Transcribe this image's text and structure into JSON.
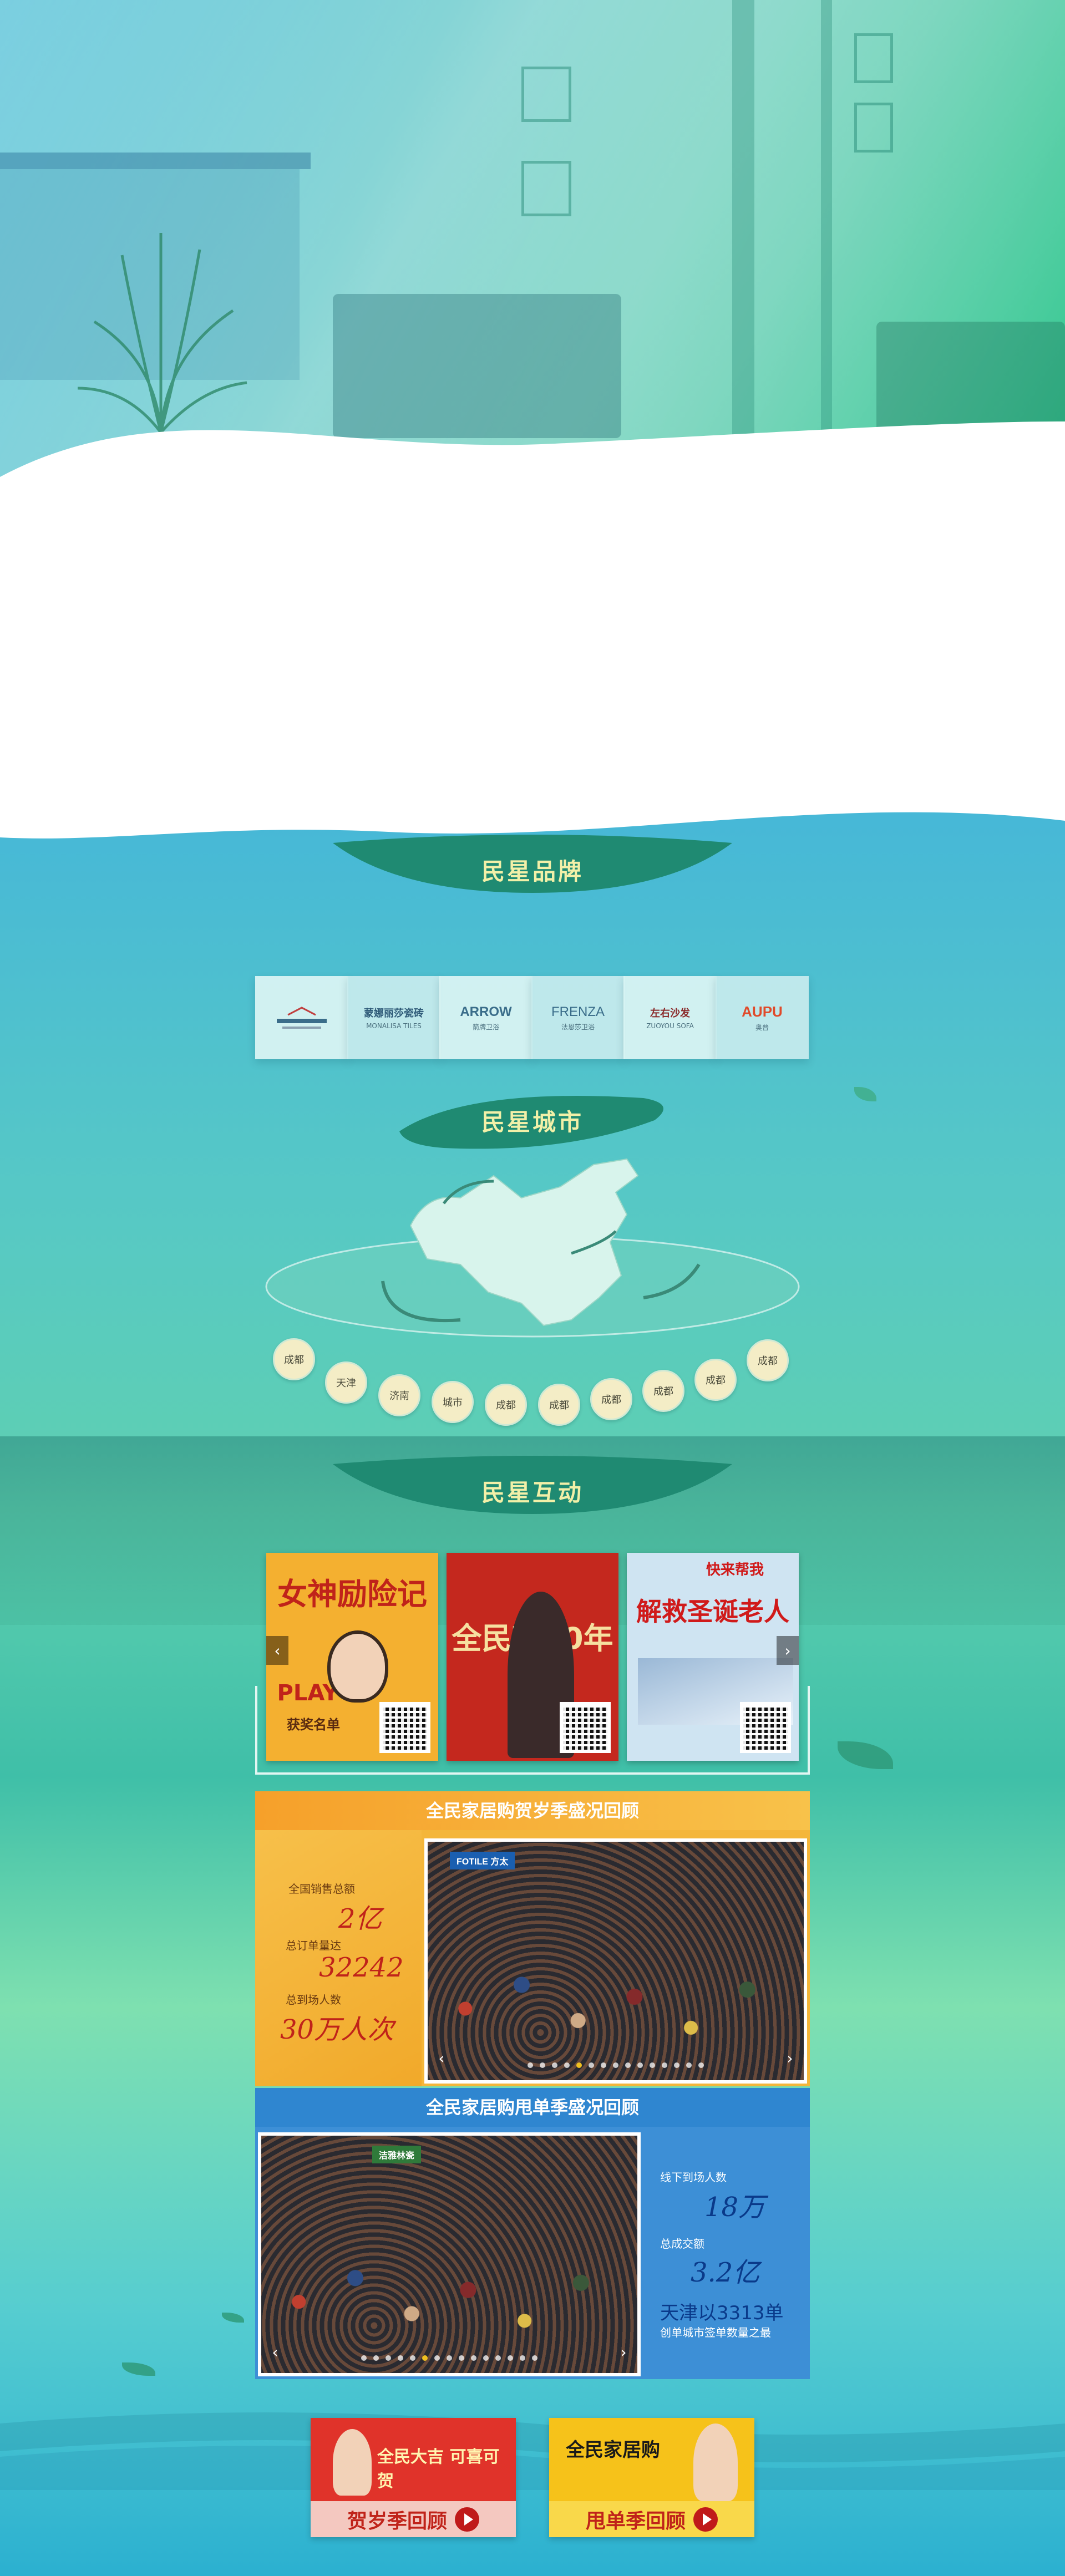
{
  "sections": {
    "brands_title": "民星品牌",
    "city_title": "民星城市",
    "interaction_title": "民星互动"
  },
  "brands": [
    {
      "name": "",
      "sub": "",
      "icon": "brand-logo-icon"
    },
    {
      "name": "蒙娜丽莎瓷砖",
      "sub": "MONALISA TILES"
    },
    {
      "name": "ARROW",
      "sub": "箭牌卫浴"
    },
    {
      "name": "FRENZA",
      "sub": "法恩莎卫浴"
    },
    {
      "name": "左右沙发",
      "sub": "ZUOYOU SOFA"
    },
    {
      "name": "AUPU",
      "sub": "奥普"
    }
  ],
  "cities": [
    "成都",
    "天津",
    "济南",
    "城市",
    "成都",
    "成都",
    "成都",
    "成都",
    "成都",
    "成都"
  ],
  "posters": [
    {
      "title": "女神励险记",
      "tag": "PLAY",
      "sub": "获奖名单",
      "bg": "#f4b030",
      "color": "#c0231a"
    },
    {
      "title": "全民新30年",
      "sub": "",
      "bg": "#c4281e",
      "color": "#f6e0a0"
    },
    {
      "title": "解救圣诞老人",
      "sub": "快来帮我",
      "bg": "#cfe4f2",
      "color": "#d01a1a"
    }
  ],
  "recap_orange": {
    "title": "全民家居购贺岁季盛况回顾",
    "sign": "FOTILE 方太",
    "stats": [
      {
        "label": "全国销售总额",
        "value": "2亿"
      },
      {
        "label": "总订单量达",
        "value": "32242"
      },
      {
        "label": "总到场人数",
        "value": "30万人次"
      }
    ]
  },
  "recap_blue": {
    "title": "全民家居购甩单季盛况回顾",
    "sign": "洁雅林瓷",
    "stats": [
      {
        "label": "线下到场人数",
        "value": "18万"
      },
      {
        "label": "总成交额",
        "value": "3.2亿"
      }
    ],
    "highlight": "天津以3313单",
    "highlight_sub": "创单城市签单数量之最"
  },
  "promos": [
    {
      "banner": "全民大吉 可喜可贺",
      "label": "贺岁季回顾",
      "bg": "#e0332a"
    },
    {
      "banner": "全民家居购",
      "label": "甩单季回顾",
      "bg": "#f6c21a"
    }
  ],
  "colors": {
    "title_text": "#f2f0a8",
    "title_bg": "#1f8a72",
    "orange": "#f4b63a",
    "blue": "#3d8fd6",
    "stat_red": "#c0231a"
  }
}
